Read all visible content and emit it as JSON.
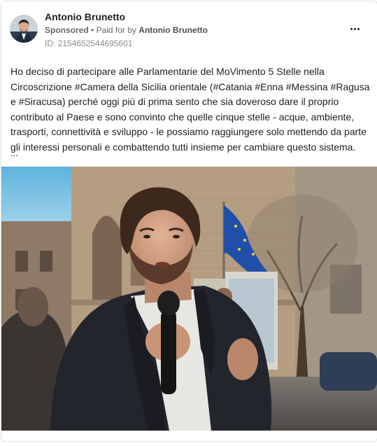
{
  "post": {
    "page_name": "Antonio Brunetto",
    "sponsored_label": "Sponsored",
    "separator": "•",
    "paid_for_label": "Paid for by",
    "payer_name": "Antonio Brunetto",
    "ad_id": "ID: 2154652544695601",
    "body_text": "Ho deciso di partecipare alle Parlamentarie del MoVimento 5 Stelle nella\nCircoscrizione #Camera della Sicilia orientale (#Catania #Enna #Messina #Ragusa\ne #Siracusa) perché oggi più di prima sento che sia doveroso dare il proprio\ncontributo al Paese e sono convinto che quelle cinque stelle - acque, ambiente,\ntrasporti, connettività e sviluppo - le possiamo raggiungere solo mettendo da parte\ngli interessi personali e combattendo tutti insieme per cambiare questo sistema.",
    "truncation": "...",
    "more_icon": "more-horizontal-icon"
  },
  "colors": {
    "text": "#1c1e21",
    "secondary_text": "#65676b",
    "muted_text": "#8a8d91",
    "card_border": "#dcdfe3",
    "flag_blue": "#1f4fa8",
    "sky": "#8cc9e8"
  }
}
